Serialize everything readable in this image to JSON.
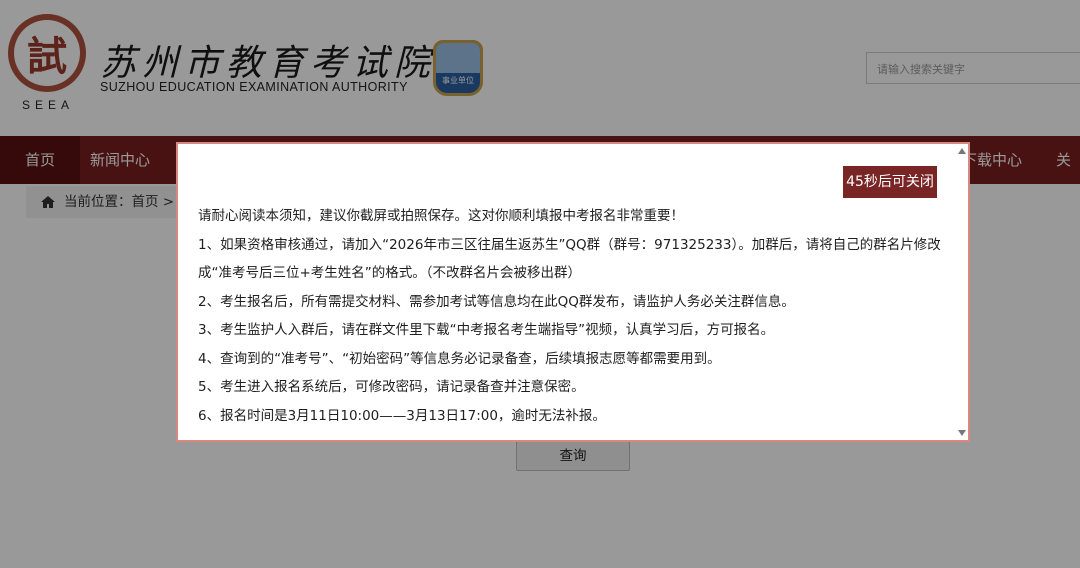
{
  "header": {
    "seal_char": "試",
    "seal_abbr": "SEEA",
    "site_name_cn": "苏州市教育考试院",
    "site_name_en": "SUZHOU EDUCATION EXAMINATION AUTHORITY",
    "badge_label": "事业单位",
    "search_placeholder": "请输入搜索关键字"
  },
  "nav": {
    "items": [
      "首页",
      "新闻中心",
      "下载中心",
      "关于"
    ]
  },
  "breadcrumb": {
    "label": "当前位置：",
    "home": "首页",
    "separator": "> ‹"
  },
  "main": {
    "query_button": "查询"
  },
  "modal": {
    "close_button": "45秒后可关闭",
    "lines": [
      "请耐心阅读本须知，建议你截屏或拍照保存。这对你顺利填报中考报名非常重要！",
      "1、如果资格审核通过，请加入“2026年市三区往届生返苏生”QQ群（群号：971325233）。加群后，请将自己的群名片修改",
      "成“准考号后三位+考生姓名”的格式。（不改群名片会被移出群）",
      "2、考生报名后，所有需提交材料、需参加考试等信息均在此QQ群发布，请监护人务必关注群信息。",
      "3、考生监护人入群后，请在群文件里下载“中考报名考生端指导”视频，认真学习后，方可报名。",
      "4、查询到的“准考号”、“初始密码”等信息务必记录备查，后续填报志愿等都需要用到。",
      "5、考生进入报名系统后，可修改密码，请记录备查并注意保密。",
      "6、报名时间是3月11日10:00——3月13日17:00，逾时无法补报。"
    ]
  },
  "colors": {
    "nav_bg": "#7a1f1f",
    "close_button_bg": "#7a2525",
    "modal_border": "#d7897f"
  },
  "icons": [
    "home-icon",
    "scroll-up-icon",
    "scroll-down-icon"
  ]
}
